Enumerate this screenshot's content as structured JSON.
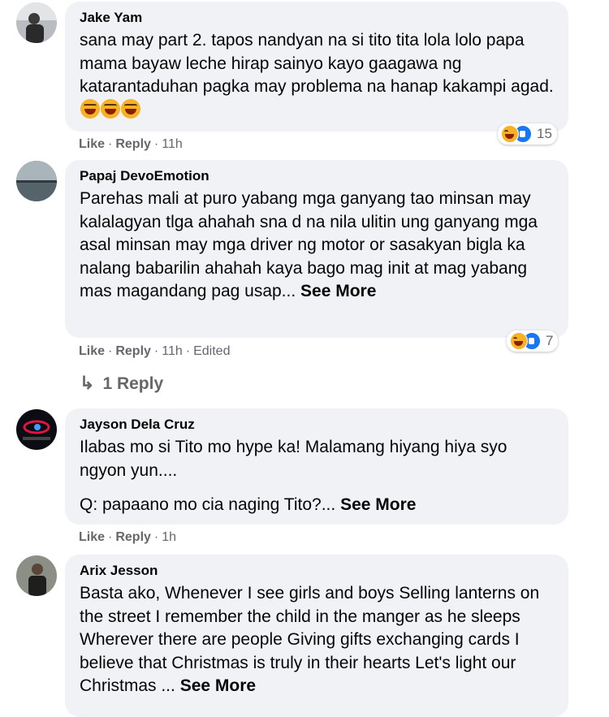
{
  "comments": [
    {
      "author": "Jake Yam",
      "text": "sana may part 2. tapos nandyan na si tito tita lola lolo papa mama bayaw leche hirap sainyo kayo gaagawa ng katarantaduhan pagka may problema na hanap kakampi agad.",
      "like": "Like",
      "reply": "Reply",
      "time": "11h",
      "reaction_count": "15"
    },
    {
      "author": "Papaj DevoEmotion",
      "text": "Parehas mali at puro yabang mga ganyang tao minsan may kalalagyan tlga ahahah sna d na nila ulitin ung ganyang mga asal minsan may mga driver ng motor or sasakyan bigla ka nalang babarilin ahahah kaya bago mag init at mag yabang mas magandang pag usap...",
      "see_more": "See More",
      "like": "Like",
      "reply": "Reply",
      "time": "11h",
      "edited": "Edited",
      "reaction_count": "7",
      "replies_link": "1 Reply"
    },
    {
      "author": "Jayson Dela Cruz",
      "text": "Ilabas mo si Tito mo hype ka! Malamang hiyang hiya syo ngyon yun....",
      "text2": "Q: papaano mo cia naging Tito?...",
      "see_more": "See More",
      "like": "Like",
      "reply": "Reply",
      "time": "1h"
    },
    {
      "author": "Arix Jesson",
      "text": "Basta ako, Whenever I see girls and boys Selling lanterns on the street I remember the child in the manger as he sleeps Wherever there are people Giving gifts exchanging cards I believe that Christmas is truly in their hearts Let's light our Christmas ...",
      "see_more": "See More"
    }
  ],
  "separator": "·",
  "colors": {
    "bubble": "#f0f2f5",
    "meta": "#65676b",
    "like_blue": "#1877f2",
    "haha_yellow": "#f7b125"
  }
}
